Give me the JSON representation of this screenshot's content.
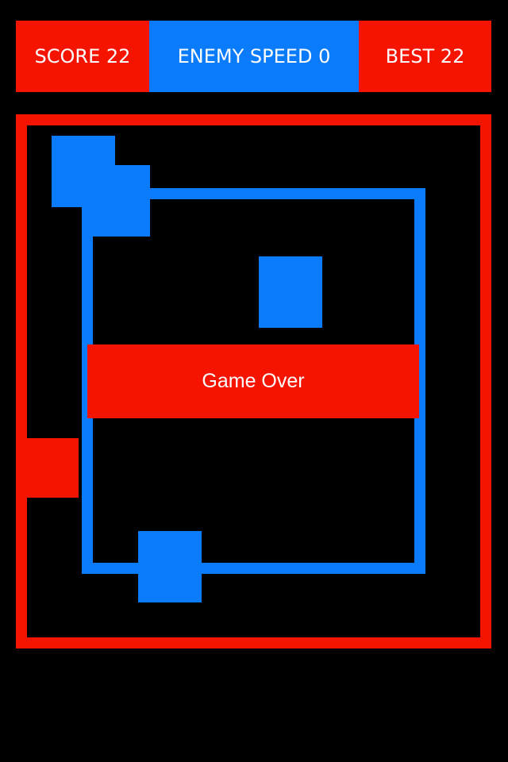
{
  "colors": {
    "background": "#000000",
    "red": "#f41400",
    "blue": "#0a7bfa",
    "text": "#ffffff"
  },
  "hud": {
    "score_label": "SCORE 22",
    "enemy_speed_label": "ENEMY SPEED 0",
    "best_label": "BEST 22"
  },
  "game": {
    "status_message": "Game Over",
    "outer_frame_color": "red",
    "track_color": "blue"
  }
}
